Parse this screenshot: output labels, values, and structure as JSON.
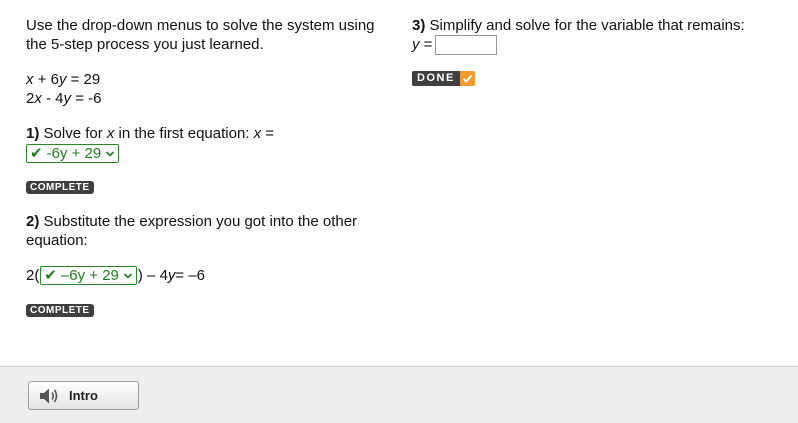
{
  "left": {
    "instructions": "Use the drop-down menus to solve the system using the 5-step process you just learned.",
    "equation1": {
      "pre": "x",
      "mid": " + 6",
      "var": "y",
      "post": " = 29"
    },
    "equation2": {
      "pre": "2",
      "var1": "x",
      "mid": " - 4",
      "var2": "y",
      "post": " = -6"
    },
    "step1": {
      "number": "1)",
      "text_before": " Solve for ",
      "var": "x",
      "text_after": " in the first equation: ",
      "answer_var": "x",
      "equals": " =",
      "dropdown_value": "-6y + 29",
      "status": "COMPLETE"
    },
    "step2": {
      "number": "2)",
      "text": " Substitute the expression you got into the other equation:",
      "prefix": "2(",
      "dropdown_value": "–6y + 29",
      "suffix_a": ") – 4",
      "suffix_var": "y",
      "suffix_b": " = –6",
      "status": "COMPLETE"
    }
  },
  "right": {
    "step3": {
      "number": "3)",
      "text": " Simplify and solve for the variable that remains:",
      "answer_var": "y",
      "equals": " =",
      "input_value": "",
      "done_label": "DONE"
    }
  },
  "footer": {
    "intro_label": "Intro",
    "icon": "speaker-icon"
  },
  "colors": {
    "correct_green": "#1e7d1e",
    "badge_dark": "#3f3f3f",
    "done_orange": "#f29a2e",
    "footer_bg": "#eeeeee"
  }
}
